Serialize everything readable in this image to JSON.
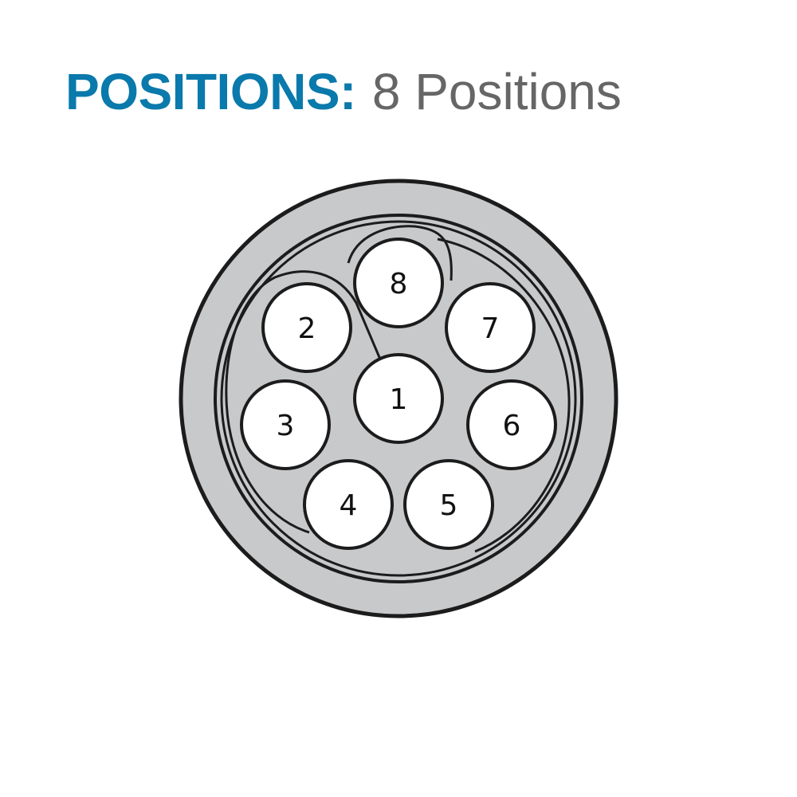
{
  "title": {
    "label": "POSITIONS:",
    "value": "8 Positions"
  },
  "colors": {
    "label": "#0a79ab",
    "value": "#666666",
    "shell": "#c8c9cb",
    "stroke": "#1c1c1c",
    "contact": "#ffffff"
  },
  "connector": {
    "positions": [
      {
        "id": "1",
        "label": "1"
      },
      {
        "id": "2",
        "label": "2"
      },
      {
        "id": "3",
        "label": "3"
      },
      {
        "id": "4",
        "label": "4"
      },
      {
        "id": "5",
        "label": "5"
      },
      {
        "id": "6",
        "label": "6"
      },
      {
        "id": "7",
        "label": "7"
      },
      {
        "id": "8",
        "label": "8"
      }
    ]
  }
}
